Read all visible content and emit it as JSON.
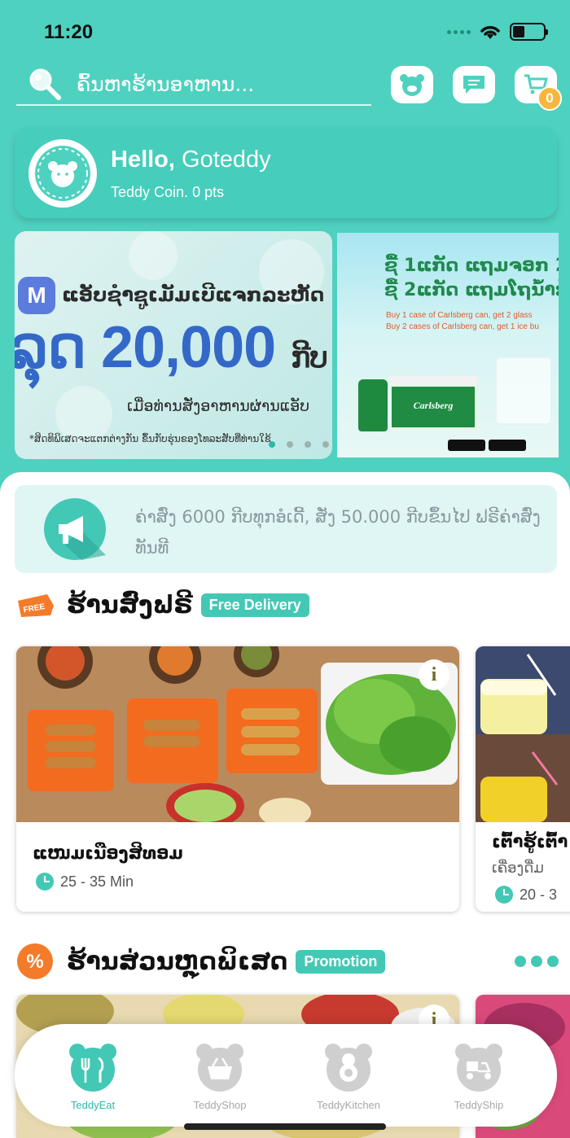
{
  "status_bar": {
    "time": "11:20"
  },
  "search": {
    "placeholder": "ຄົ້ນຫາຮ້ານອາຫານ..."
  },
  "header_buttons": {
    "cart_count": "0"
  },
  "profile": {
    "hello": "Hello,",
    "name": "Goteddy",
    "coin_label": "Teddy Coin.",
    "points": "0 pts"
  },
  "banner_main": {
    "line1": "ແອັບຊຳຊູເມັມເບີແຈກລະຫັດ",
    "big_value": "ລຸດ 20,000",
    "big_unit": "ກີບ",
    "line3": "ເມື່ອທ່ານສັ່ງອາຫານຜ່ານແອັບ",
    "footnote": "*ສິດທິພິເສດຈະແຕກຕ່າງກັນ ຂຶ້ນກັບຮຸ່ນຂອງໂທລະສັບທີ່ທ່ານໃຊ້"
  },
  "banner_side": {
    "line1": "ຊື້ 1ແກັດ ແຖມຈອກ 2",
    "line2": "ຊື້ 2ແກັດ ແຖມໂຖນ້ຳກ້ອນ",
    "sub1": "Buy 1 case of Carlsberg can, get 2 glass",
    "sub2": "Buy 2 cases of Carlsberg can, get 1 ice bu",
    "brand": "Carlsberg"
  },
  "notice": {
    "text": "ຄ່າສົ່ງ 6000 ກີບທຸກອໍເດີ້, ສັ່ງ 50.000 ກີບຂຶ້ນໄປ ຟຣີຄ່າສົ່ງທັນທີ"
  },
  "free_section": {
    "tag": "FREE",
    "title": "ຮ້ານສົ່ງຟຣີ",
    "pill": "Free Delivery",
    "cards": [
      {
        "name": "ແໜມເນືອງສິທອມ",
        "time": "25 - 35 Min"
      },
      {
        "name": "ເຕົ້າຮູ້ເຕົ້າ",
        "category": "ເຄື່ອງດື່ມ",
        "time": "20 - 3"
      }
    ]
  },
  "promo_section": {
    "tag": "%",
    "title": "ຮ້ານສ່ວນຫຼຸດພິເສດ",
    "pill": "Promotion"
  },
  "bottom_nav": {
    "items": [
      {
        "label": "TeddyEat",
        "active": true
      },
      {
        "label": "TeddyShop",
        "active": false
      },
      {
        "label": "TeddyKitchen",
        "active": false
      },
      {
        "label": "TeddyShip",
        "active": false
      }
    ]
  },
  "colors": {
    "teal": "#4fd1c0",
    "accent": "#43c8b6",
    "orange": "#f47b2a",
    "badge": "#f6b73c"
  }
}
